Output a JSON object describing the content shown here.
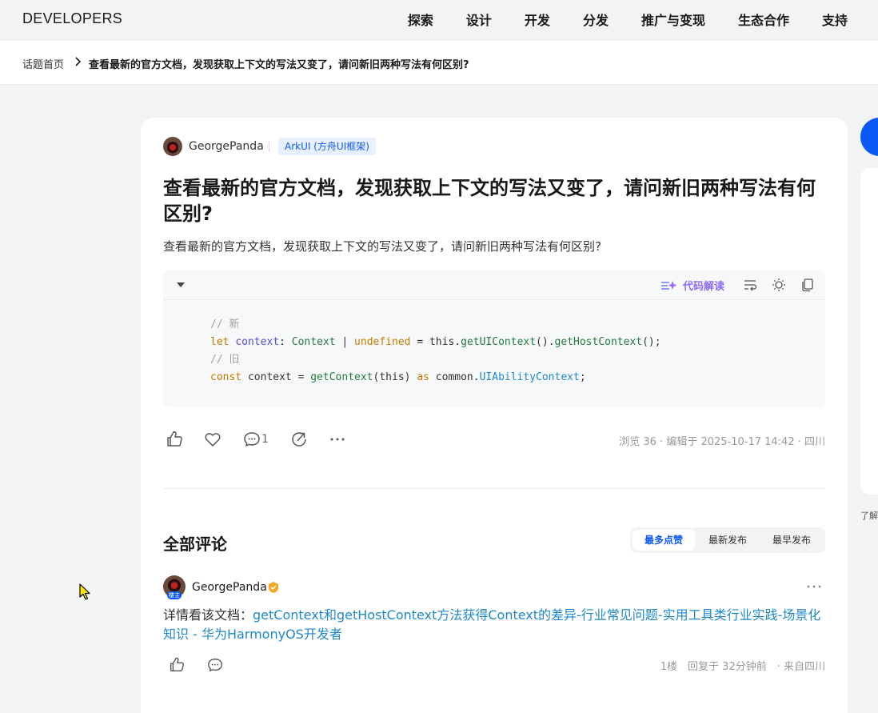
{
  "nav": {
    "logo": "DEVELOPERS",
    "links": [
      "探索",
      "设计",
      "开发",
      "分发",
      "推广与变现",
      "生态合作",
      "支持"
    ]
  },
  "breadcrumb": {
    "home": "话题首页",
    "current": "查看最新的官方文档，发现获取上下文的写法又变了，请问新旧两种写法有何区别?"
  },
  "post": {
    "author": "GeorgePanda",
    "tag": "ArkUI (方舟UI框架)",
    "title": "查看最新的官方文档，发现获取上下文的写法又变了，请问新旧两种写法有何区别?",
    "description": "查看最新的官方文档，发现获取上下文的写法又变了，请问新旧两种写法有何区别?",
    "code_explain_label": "代码解读",
    "code": {
      "line1_comment": "// 新",
      "line2": {
        "kw": "let",
        "var": "context",
        "colon": ": ",
        "type": "Context",
        "pipe": " | ",
        "undef": "undefined",
        "eq": " = ",
        "this": "this.",
        "fn1": "getUIContext",
        "mid": "().",
        "fn2": "getHostContext",
        "end": "();"
      },
      "line3_comment": "// 旧",
      "line4": {
        "kw": "const",
        "rest1": " context = ",
        "fn": "getContext",
        "args": "(this) ",
        "as": "as",
        "rest2": " common.",
        "type": "UIAbilityContext",
        "end": ";"
      }
    },
    "comment_count": "1",
    "meta": "浏览 36 · 编辑于 2025-10-17 14:42 · 四川"
  },
  "comments": {
    "title": "全部评论",
    "sort_tabs": [
      "最多点赞",
      "最新发布",
      "最早发布"
    ],
    "active_sort": "最多点赞",
    "items": [
      {
        "author": "GeorgePanda",
        "owner_badge": "楼主",
        "text_prefix": "详情看该文档：",
        "link_text": "getContext和getHostContext方法获得Context的差异-行业常见问题-实用工具类行业实践-场景化知识 - 华为HarmonyOS开发者",
        "meta": "1楼　回复于 32分钟前　·  来自四川"
      }
    ]
  },
  "right_column": {
    "partial_text": "了解"
  },
  "colors": {
    "accent": "#0a59f7",
    "link": "#1e88c8",
    "explain": "#8a6cf5",
    "page_bg": "#f1f3f5"
  }
}
